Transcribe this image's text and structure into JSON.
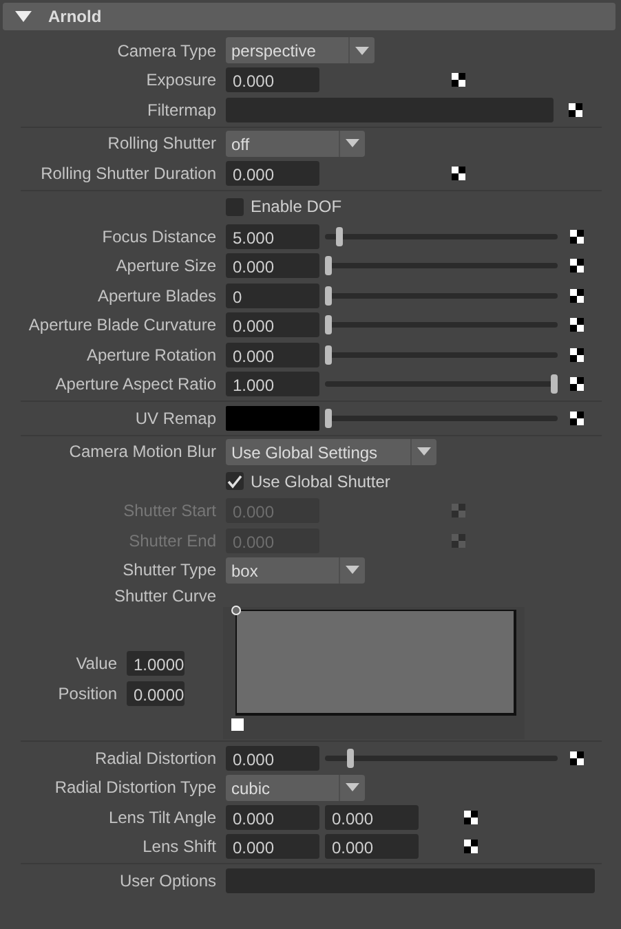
{
  "section": {
    "title": "Arnold",
    "expanded": true
  },
  "groups": [
    [
      {
        "kind": "dropdown",
        "label": "Camera Type",
        "value": "perspective",
        "disabled": false
      },
      {
        "kind": "number",
        "label": "Exposure",
        "value": "0.000",
        "disabled": false
      },
      {
        "kind": "texture",
        "label": "Filtermap",
        "disabled": false
      }
    ],
    [
      {
        "kind": "dropdown",
        "label": "Rolling Shutter",
        "value": "off",
        "disabled": false
      },
      {
        "kind": "number",
        "label": "Rolling Shutter Duration",
        "value": "0.000",
        "disabled": false
      }
    ],
    [
      {
        "kind": "checkbox",
        "label": "Enable DOF",
        "checked": false,
        "disabled": false
      },
      {
        "kind": "slider",
        "label": "Focus Distance",
        "value": "5.000",
        "level": 0.05,
        "disabled": false
      },
      {
        "kind": "slider",
        "label": "Aperture Size",
        "value": "0.000",
        "level": 0,
        "disabled": false
      },
      {
        "kind": "slider",
        "label": "Aperture Blades",
        "value": "0",
        "level": 0,
        "disabled": false
      },
      {
        "kind": "slider",
        "label": "Aperture Blade Curvature",
        "value": "0.000",
        "level": 0,
        "disabled": false
      },
      {
        "kind": "slider",
        "label": "Aperture Rotation",
        "value": "0.000",
        "level": 0,
        "disabled": false
      },
      {
        "kind": "slider",
        "label": "Aperture Aspect Ratio",
        "value": "1.000",
        "level": 1,
        "disabled": false
      }
    ],
    [
      {
        "kind": "color",
        "label": "UV Remap",
        "color": "#000000",
        "level": 0,
        "disabled": false
      }
    ],
    [
      {
        "kind": "dropdown",
        "label": "Camera Motion Blur",
        "value": "Use Global Settings",
        "disabled": false
      },
      {
        "kind": "checkbox",
        "label": "Use Global Shutter",
        "checked": true,
        "disabled": false
      },
      {
        "kind": "number",
        "label": "Shutter Start",
        "value": "0.000",
        "disabled": true
      },
      {
        "kind": "number",
        "label": "Shutter End",
        "value": "0.000",
        "disabled": true
      },
      {
        "kind": "dropdown",
        "label": "Shutter Type",
        "value": "box",
        "disabled": false
      },
      {
        "kind": "curve",
        "label": "Shutter Curve",
        "disabled": false,
        "fields": [
          {
            "label": "Value",
            "value": "1.0000"
          },
          {
            "label": "Position",
            "value": "0.0000"
          }
        ]
      }
    ],
    [
      {
        "kind": "slider",
        "label": "Radial Distortion",
        "value": "0.000",
        "level": 0.1,
        "disabled": false
      },
      {
        "kind": "dropdown",
        "label": "Radial Distortion Type",
        "value": "cubic",
        "disabled": false
      },
      {
        "kind": "pair",
        "label": "Lens Tilt Angle",
        "values": [
          "0.000",
          "0.000"
        ],
        "disabled": false
      },
      {
        "kind": "pair",
        "label": "Lens Shift",
        "values": [
          "0.000",
          "0.000"
        ],
        "disabled": false
      }
    ],
    [
      {
        "kind": "text",
        "label": "User Options",
        "disabled": false
      }
    ]
  ]
}
